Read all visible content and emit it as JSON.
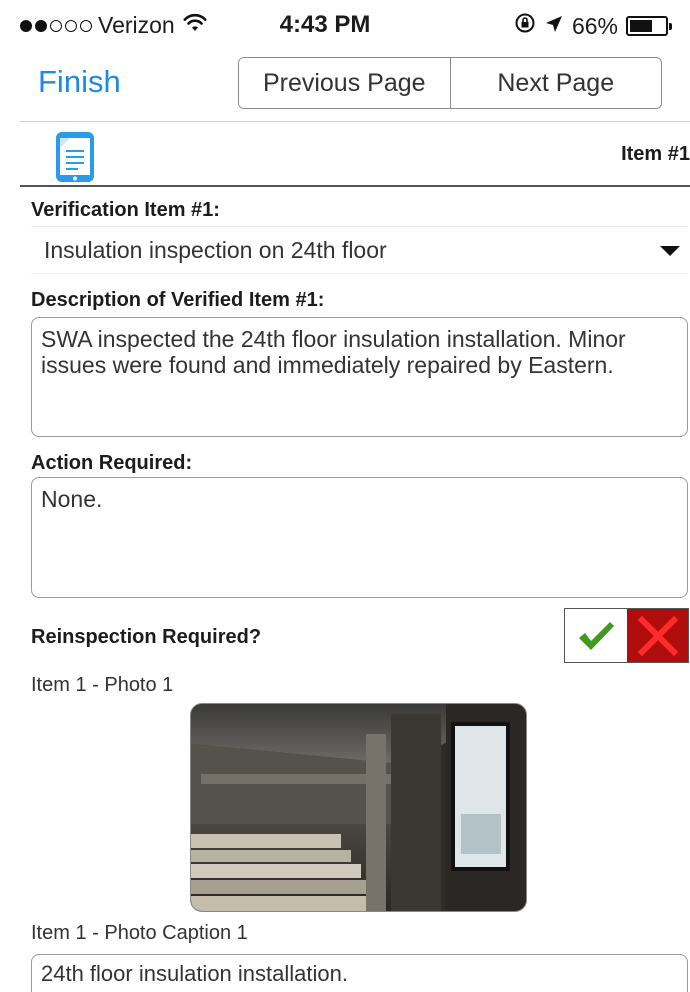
{
  "status_bar": {
    "carrier": "Verizon",
    "time": "4:43 PM",
    "battery": "66%",
    "battery_level": 0.66,
    "icons": [
      "signal-dots-icon",
      "wifi-icon",
      "rotation-lock-icon",
      "location-arrow-icon",
      "battery-icon"
    ]
  },
  "nav": {
    "finish_label": "Finish",
    "previous_label": "Previous Page",
    "next_label": "Next Page"
  },
  "header": {
    "icon": "mobile-document-icon",
    "item_title": "Item #1"
  },
  "form": {
    "verification_label": "Verification Item #1:",
    "verification_value": "Insulation inspection on 24th floor",
    "description_label": "Description of Verified Item #1:",
    "description_value": "SWA inspected the 24th floor insulation installation. Minor issues were found and immediately repaired by Eastern.",
    "action_label": "Action Required:",
    "action_value": "None.",
    "reinspection_label": "Reinspection Required?",
    "reinspection_yes_icon": "checkmark-icon",
    "reinspection_no_icon": "x-icon",
    "photo_label": "Item 1 - Photo 1",
    "caption_label": "Item 1 - Photo Caption 1",
    "caption_value": "24th floor insulation installation."
  },
  "colors": {
    "accent": "#1e88e5",
    "check_green": "#3f9a1e",
    "no_red": "#b00d0d"
  }
}
